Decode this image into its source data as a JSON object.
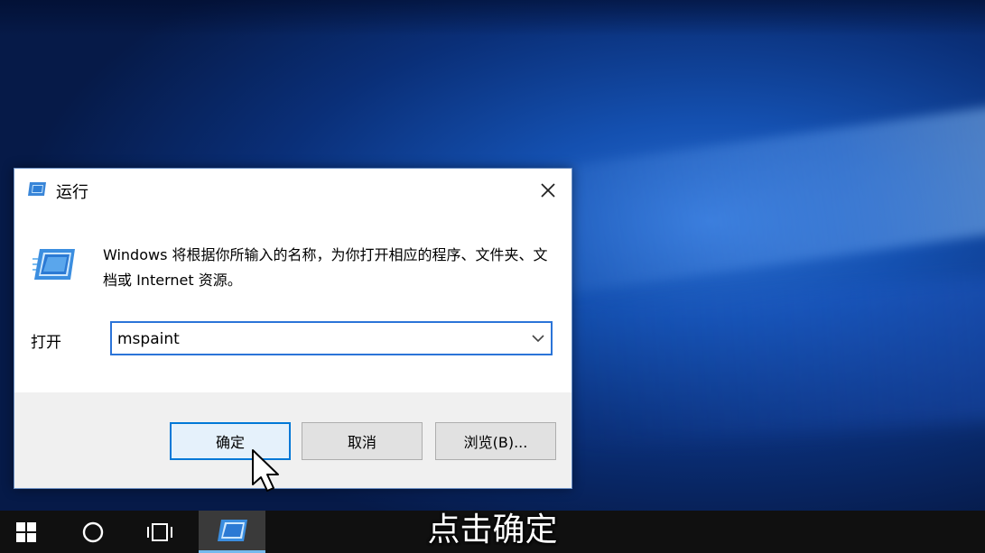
{
  "dialog": {
    "title": "运行",
    "description": "Windows 将根据你所输入的名称，为你打开相应的程序、文件夹、文档或 Internet 资源。",
    "open_label": "打开",
    "command_value": "mspaint",
    "buttons": {
      "ok": "确定",
      "cancel": "取消",
      "browse": "浏览(B)..."
    },
    "icons": {
      "title": "run-icon",
      "close": "close-icon",
      "main": "run-icon",
      "dropdown": "chevron-down-icon"
    }
  },
  "taskbar": {
    "icons": [
      "windows-start-icon",
      "cortana-circle-icon",
      "task-view-icon",
      "run-app-icon"
    ]
  },
  "subtitle": "点击确定",
  "colors": {
    "accent": "#0078d7",
    "taskbar": "#101010",
    "desktop": "#1450b0"
  }
}
